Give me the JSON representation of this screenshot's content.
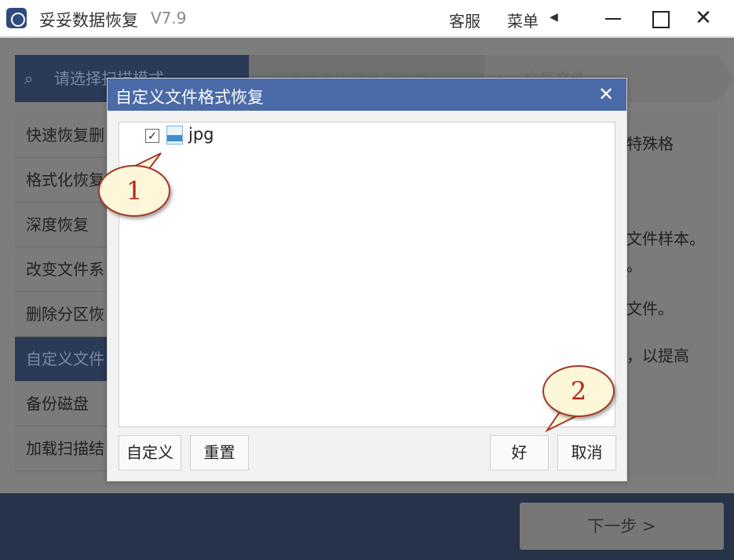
{
  "titlebar": {
    "app_name": "妥妥数据恢复",
    "version": "V7.9",
    "kefu": "客服",
    "menu": "菜单",
    "menu_arrow": "◀"
  },
  "steps": [
    {
      "label": "请选择扫描模式",
      "icon": "search-icon"
    },
    {
      "label": "选择丢失文件的位置",
      "icon": "folder-icon"
    },
    {
      "label": "恢复文件",
      "icon": "home-icon"
    }
  ],
  "left_list": [
    {
      "label": "快速恢复删"
    },
    {
      "label": "格式化恢复"
    },
    {
      "label": "深度恢复"
    },
    {
      "label": "改变文件系"
    },
    {
      "label": "删除分区恢"
    },
    {
      "label": "自定义文件"
    },
    {
      "label": "备份磁盘"
    },
    {
      "label": "加载扫描结"
    }
  ],
  "right_fragments": [
    "特殊格",
    "文件样本。",
    "。",
    "文件。",
    "，以提高"
  ],
  "next_button": "下一步 >",
  "dialog": {
    "title": "自定义文件格式恢复",
    "close": "✕",
    "files": [
      {
        "name": "jpg",
        "checked": true,
        "icon": "jpg-file-icon",
        "check_mark": "✓"
      }
    ],
    "buttons": {
      "custom": "自定义",
      "reset": "重置",
      "ok": "好",
      "cancel": "取消"
    }
  },
  "annotations": [
    "1",
    "2"
  ],
  "colors": {
    "dialog_header": "#4a6aa8",
    "active_item": "#2b3b57",
    "bubble_fill": "#fdf6d8",
    "bubble_text": "#b0281c"
  }
}
